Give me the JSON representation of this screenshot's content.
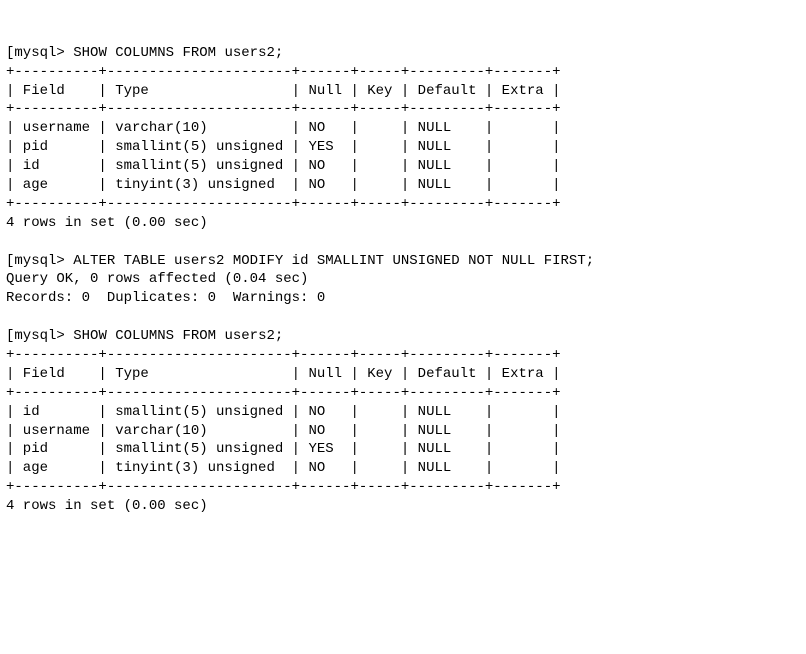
{
  "session": [
    {
      "prompt": "mysql>",
      "command": "SHOW COLUMNS FROM users2;",
      "table": {
        "border": "+----------+----------------------+------+-----+---------+-------+",
        "header": "| Field    | Type                 | Null | Key | Default | Extra |",
        "rows": [
          "| username | varchar(10)          | NO   |     | NULL    |       |",
          "| pid      | smallint(5) unsigned | YES  |     | NULL    |       |",
          "| id       | smallint(5) unsigned | NO   |     | NULL    |       |",
          "| age      | tinyint(3) unsigned  | NO   |     | NULL    |       |"
        ]
      },
      "summary": "4 rows in set (0.00 sec)"
    },
    {
      "prompt": "mysql>",
      "command": "ALTER TABLE users2 MODIFY id SMALLINT UNSIGNED NOT NULL FIRST;",
      "status": "Query OK, 0 rows affected (0.04 sec)",
      "records": "Records: 0  Duplicates: 0  Warnings: 0"
    },
    {
      "prompt": "mysql>",
      "command": "SHOW COLUMNS FROM users2;",
      "table": {
        "border": "+----------+----------------------+------+-----+---------+-------+",
        "header": "| Field    | Type                 | Null | Key | Default | Extra |",
        "rows": [
          "| id       | smallint(5) unsigned | NO   |     | NULL    |       |",
          "| username | varchar(10)          | NO   |     | NULL    |       |",
          "| pid      | smallint(5) unsigned | YES  |     | NULL    |       |",
          "| age      | tinyint(3) unsigned  | NO   |     | NULL    |       |"
        ]
      },
      "summary": "4 rows in set (0.00 sec)"
    }
  ],
  "chart_data": {
    "type": "table",
    "tables": [
      {
        "title": "SHOW COLUMNS FROM users2 (before ALTER)",
        "columns": [
          "Field",
          "Type",
          "Null",
          "Key",
          "Default",
          "Extra"
        ],
        "rows": [
          [
            "username",
            "varchar(10)",
            "NO",
            "",
            "NULL",
            ""
          ],
          [
            "pid",
            "smallint(5) unsigned",
            "YES",
            "",
            "NULL",
            ""
          ],
          [
            "id",
            "smallint(5) unsigned",
            "NO",
            "",
            "NULL",
            ""
          ],
          [
            "age",
            "tinyint(3) unsigned",
            "NO",
            "",
            "NULL",
            ""
          ]
        ]
      },
      {
        "title": "SHOW COLUMNS FROM users2 (after ALTER)",
        "columns": [
          "Field",
          "Type",
          "Null",
          "Key",
          "Default",
          "Extra"
        ],
        "rows": [
          [
            "id",
            "smallint(5) unsigned",
            "NO",
            "",
            "NULL",
            ""
          ],
          [
            "username",
            "varchar(10)",
            "NO",
            "",
            "NULL",
            ""
          ],
          [
            "pid",
            "smallint(5) unsigned",
            "YES",
            "",
            "NULL",
            ""
          ],
          [
            "age",
            "tinyint(3) unsigned",
            "NO",
            "",
            "NULL",
            ""
          ]
        ]
      }
    ]
  }
}
